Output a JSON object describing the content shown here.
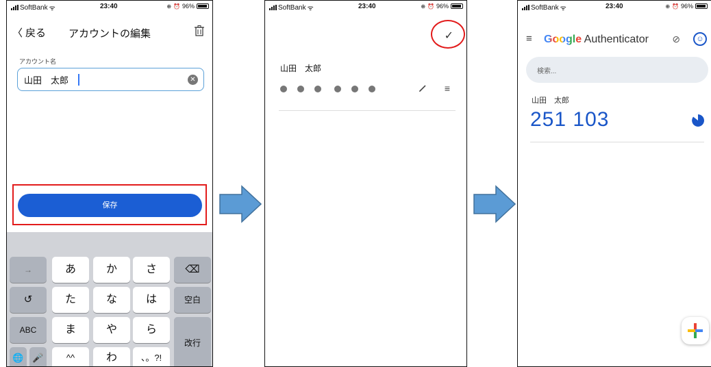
{
  "colors": {
    "accent_blue": "#1b5ed4",
    "highlight_red": "#e21b1b",
    "arrow_fill": "#5b9bd5",
    "arrow_stroke": "#41719c",
    "code_blue": "#1a56c8"
  },
  "status": {
    "carrier": "SoftBank",
    "time": "23:40",
    "battery": "96%"
  },
  "screen1": {
    "back_label": "戻る",
    "title": "アカウントの編集",
    "field_label": "アカウント名",
    "account_name_value": "山田　太郎",
    "save_label": "保存",
    "keyboard": {
      "row1": [
        "→",
        "あ",
        "か",
        "さ",
        "⌫"
      ],
      "row2": [
        "↺",
        "た",
        "な",
        "は",
        "空白"
      ],
      "row3": [
        "ABC",
        "ま",
        "や",
        "ら"
      ],
      "row4": [
        "🌐",
        "🎤",
        "^^",
        "わ",
        "、。?!"
      ],
      "enter": "改行"
    }
  },
  "screen2": {
    "account_name": "山田　太郎",
    "masked_dots": 6
  },
  "screen3": {
    "brand_google": "Google",
    "brand_app": " Authenticator",
    "search_placeholder": "検索...",
    "account_name": "山田　太郎",
    "code": "251 103",
    "fab_label": "+"
  }
}
